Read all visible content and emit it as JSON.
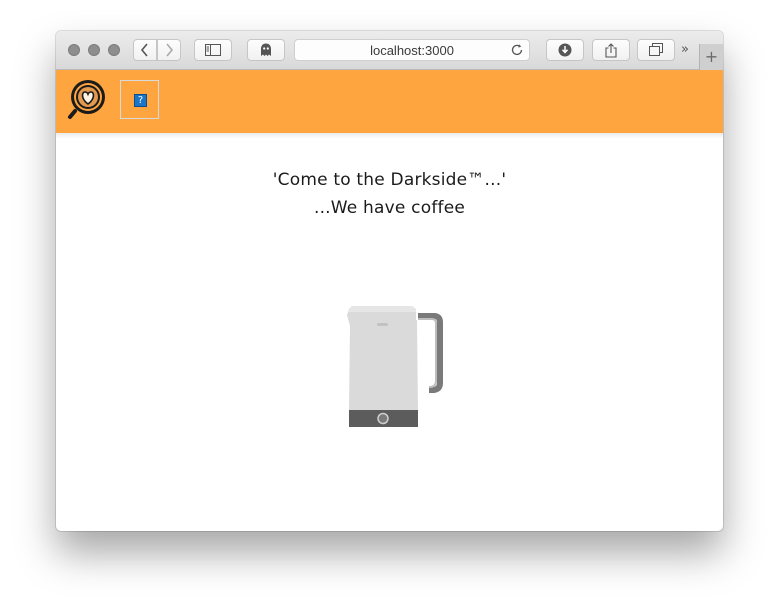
{
  "browser": {
    "url": "localhost:3000",
    "more_tabs_label": "»",
    "new_tab_label": "+"
  },
  "header": {
    "logo_icon": "coffee-heart-logo-icon",
    "broken_image_icon": "broken-image-icon",
    "broken_image_glyph": "?",
    "background_color": "#ffa53f"
  },
  "main": {
    "tagline_line1": "'Come to the Darkside™...'",
    "tagline_line2": "...We have coffee",
    "kettle_icon": "electric-kettle-icon"
  }
}
